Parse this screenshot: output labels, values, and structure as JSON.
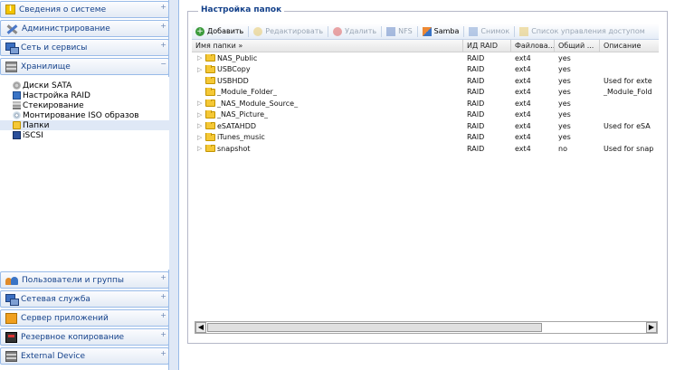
{
  "sidebar": {
    "sections_top": [
      {
        "label": "Сведения о системе",
        "icon": "info-icon"
      },
      {
        "label": "Администрирование",
        "icon": "tools-icon"
      },
      {
        "label": "Сеть и сервисы",
        "icon": "network-icon"
      },
      {
        "label": "Хранилище",
        "icon": "storage-icon"
      }
    ],
    "storage_items": [
      {
        "label": "Диски SATA",
        "icon": "disk-icon"
      },
      {
        "label": "Настройка RAID",
        "icon": "raid-icon"
      },
      {
        "label": "Стекирование",
        "icon": "stack-icon"
      },
      {
        "label": "Монтирование ISO образов",
        "icon": "iso-icon"
      },
      {
        "label": "Папки",
        "icon": "folder-icon"
      },
      {
        "label": "iSCSI",
        "icon": "iscsi-icon"
      }
    ],
    "sections_bottom": [
      {
        "label": "Пользователи и группы",
        "icon": "users-icon"
      },
      {
        "label": "Сетевая служба",
        "icon": "network-service-icon"
      },
      {
        "label": "Сервер приложений",
        "icon": "app-server-icon"
      },
      {
        "label": "Резервное копирование",
        "icon": "backup-icon"
      },
      {
        "label": "External Device",
        "icon": "external-device-icon"
      }
    ]
  },
  "panel": {
    "title": "Настройка папок",
    "toolbar": {
      "add": "Добавить",
      "edit": "Редактировать",
      "delete": "Удалить",
      "nfs": "NFS",
      "samba": "Samba",
      "snapshot": "Снимок",
      "acl": "Список управления доступом"
    },
    "columns": {
      "name": "Имя папки »",
      "raid": "ИД RAID",
      "fs": "Файлова...",
      "shared": "Общий ...",
      "desc": "Описание"
    },
    "rows": [
      {
        "name": "NAS_Public",
        "raid": "RAID",
        "fs": "ext4",
        "shared": "yes",
        "desc": ""
      },
      {
        "name": "USBCopy",
        "raid": "RAID",
        "fs": "ext4",
        "shared": "yes",
        "desc": ""
      },
      {
        "name": "USBHDD",
        "raid": "RAID",
        "fs": "ext4",
        "shared": "yes",
        "desc": "Used for exte"
      },
      {
        "name": "_Module_Folder_",
        "raid": "RAID",
        "fs": "ext4",
        "shared": "yes",
        "desc": "_Module_Fold"
      },
      {
        "name": "_NAS_Module_Source_",
        "raid": "RAID",
        "fs": "ext4",
        "shared": "yes",
        "desc": ""
      },
      {
        "name": "_NAS_Picture_",
        "raid": "RAID",
        "fs": "ext4",
        "shared": "yes",
        "desc": ""
      },
      {
        "name": "eSATAHDD",
        "raid": "RAID",
        "fs": "ext4",
        "shared": "yes",
        "desc": "Used for eSA"
      },
      {
        "name": "iTunes_music",
        "raid": "RAID",
        "fs": "ext4",
        "shared": "yes",
        "desc": ""
      },
      {
        "name": "snapshot",
        "raid": "RAID",
        "fs": "ext4",
        "shared": "no",
        "desc": "Used for snap"
      }
    ],
    "expanders": [
      true,
      true,
      false,
      false,
      true,
      true,
      true,
      true,
      true
    ]
  },
  "colors": {
    "accent": "#15428b",
    "border": "#99bbe8",
    "background": "#dfe8f6"
  }
}
